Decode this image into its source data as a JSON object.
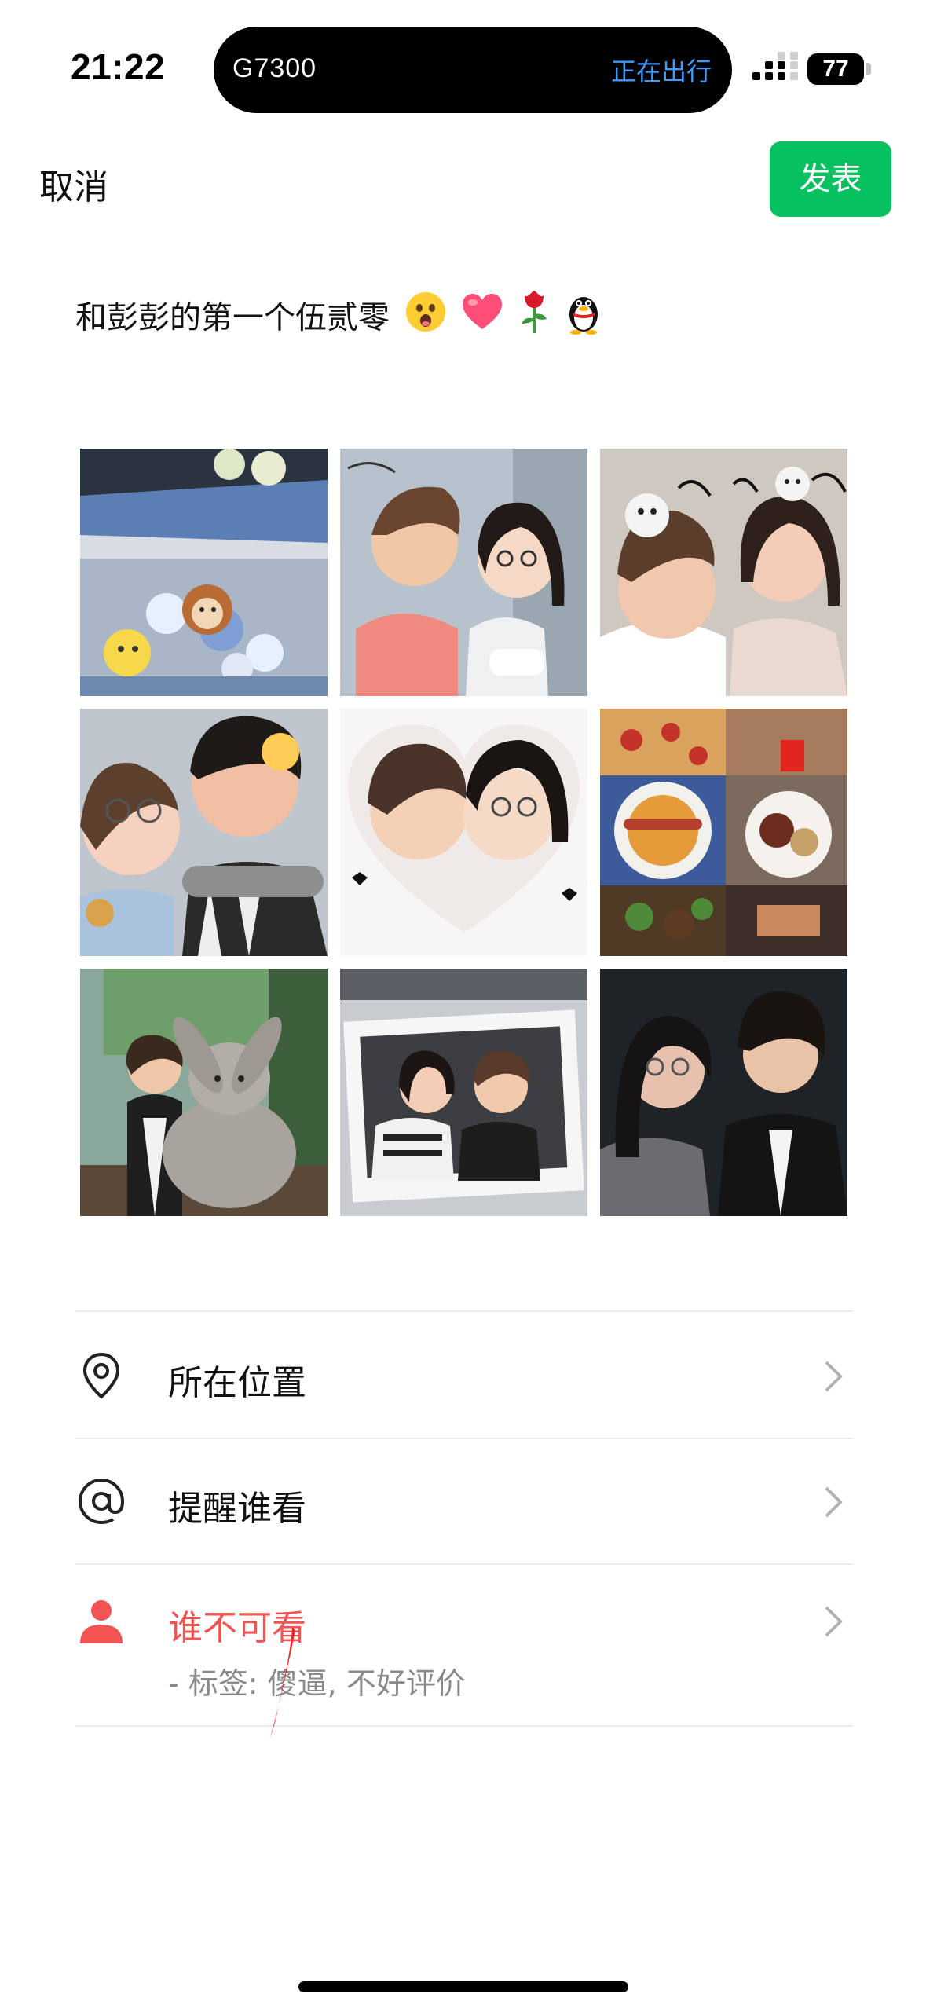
{
  "status_bar": {
    "time": "21:22",
    "live_activity": {
      "train": "G7300",
      "status": "正在出行"
    },
    "battery_level": "77"
  },
  "nav": {
    "cancel_label": "取消",
    "publish_label": "发表",
    "publish_color": "#07c160"
  },
  "post": {
    "caption_text": "和彭彭的第一个伍贰零",
    "caption_emojis": [
      "astonished-face-emoji",
      "heart-emoji",
      "rose-emoji",
      "penguin-emoji"
    ],
    "photos": [
      {
        "name": "photo-flower-bouquet"
      },
      {
        "name": "photo-couple-sticker"
      },
      {
        "name": "photo-cat-filter-selfie"
      },
      {
        "name": "photo-silly-faces-selfie"
      },
      {
        "name": "photo-heart-kiss"
      },
      {
        "name": "photo-food-collage"
      },
      {
        "name": "photo-plush-bunny"
      },
      {
        "name": "photo-car-frame"
      },
      {
        "name": "photo-night-selfie"
      }
    ]
  },
  "options": {
    "location_label": "所在位置",
    "mention_label": "提醒谁看",
    "hide_label": "谁不可看",
    "hide_detail": "- 标签: 傻逼, 不好评价",
    "hide_accent_color": "#f25353"
  }
}
